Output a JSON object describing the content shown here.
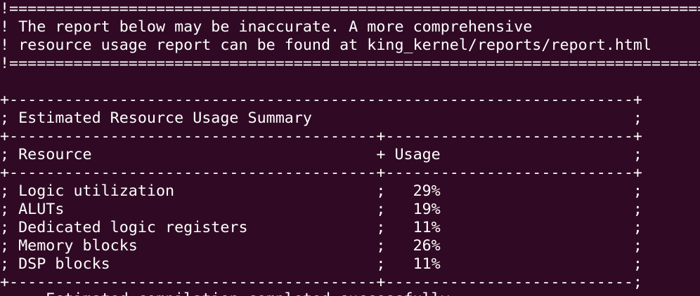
{
  "terminal": {
    "background": "#300a24",
    "foreground": "#ffffff",
    "lines": [
      "!===============================================================================",
      "! The report below may be inaccurate. A more comprehensive",
      "! resource usage report can be found at king_kernel/reports/report.html",
      "!===============================================================================",
      "",
      "+--------------------------------------------------------------------+",
      "; Estimated Resource Usage Summary                                   ;",
      "+----------------------------------------+---------------------------+",
      "; Resource                               + Usage                     ;",
      "+----------------------------------------+---------------------------+",
      "; Logic utilization                      ;   29%                     ;",
      "; ALUTs                                  ;   19%                     ;",
      "; Dedicated logic registers              ;   11%                     ;",
      "; Memory blocks                          ;   26%                     ;",
      "; DSP blocks                             ;   11%                     ;",
      "+----------------------------------------+---------------------------;",
      "     Estimated compilation completed successfully"
    ]
  }
}
